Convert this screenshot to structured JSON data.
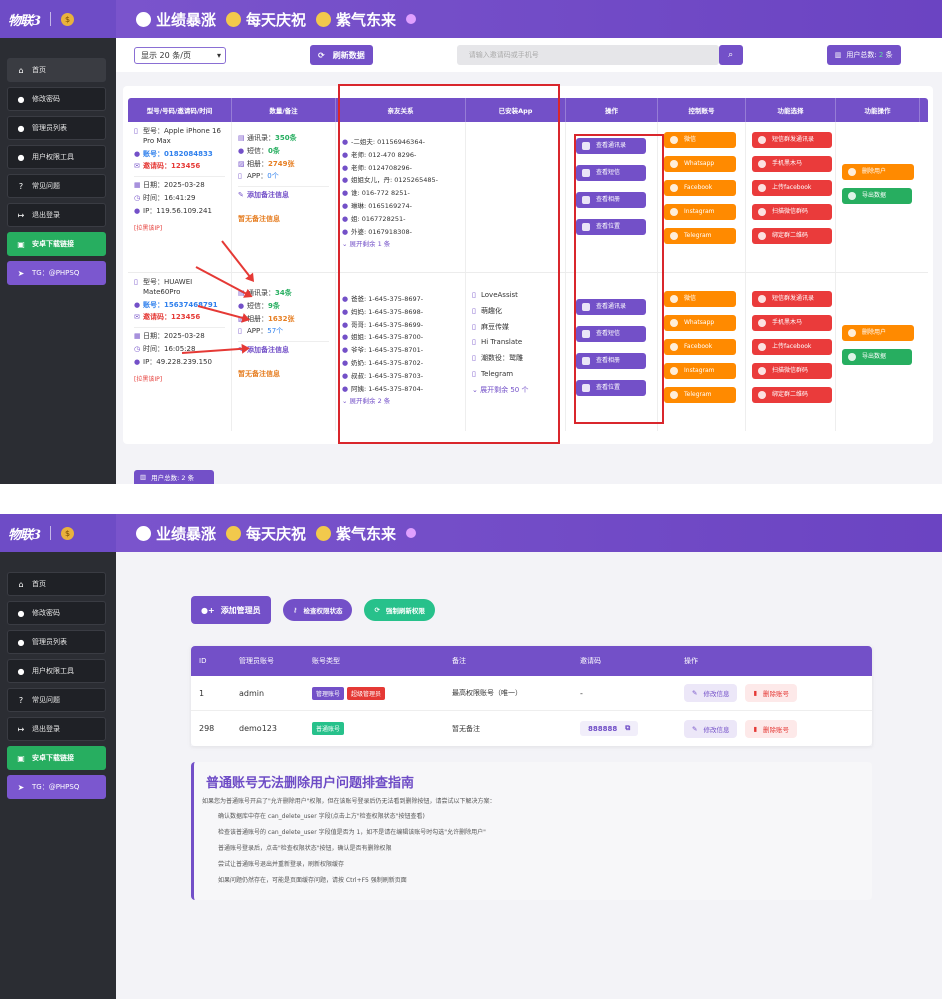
{
  "brand": {
    "logo": "物联3",
    "emoji_line": [
      "业绩暴涨",
      "每天庆祝",
      "紫气东来"
    ]
  },
  "sidebar": {
    "items": [
      {
        "label": "首页",
        "icon": "home-icon"
      },
      {
        "label": "修改密码",
        "icon": "user-edit-icon"
      },
      {
        "label": "管理员列表",
        "icon": "users-icon"
      },
      {
        "label": "用户权限工具",
        "icon": "user-tool-icon"
      },
      {
        "label": "常见问题",
        "icon": "question-icon"
      },
      {
        "label": "退出登录",
        "icon": "logout-icon"
      },
      {
        "label": "安卓下载链接",
        "icon": "android-icon"
      },
      {
        "label": "TG：@PHPSQ",
        "icon": "telegram-icon"
      }
    ]
  },
  "shot1": {
    "toolbar": {
      "page_size": "显示 20 条/页",
      "refresh": "刷新数据",
      "search_placeholder": "请输入邀请码或手机号",
      "total_label": "用户总数:",
      "total_value": "2",
      "total_unit": "条"
    },
    "headers": [
      "型号/号码/邀请码/时间",
      "数量/备注",
      "亲友关系",
      "已安装App",
      "操作",
      "控制账号",
      "功能选择",
      "功能操作"
    ],
    "rows": [
      {
        "model": "型号：Apple iPhone 16 Pro Max",
        "account": "账号：0182084833",
        "invite": "邀请码：123456",
        "date": "日期：2025-03-28",
        "time": "时间：16:41:29",
        "ip": "IP：119.56.109.241",
        "pull": "[拉黑该IP]",
        "contacts_label": "通讯录：",
        "contacts": "350条",
        "sms_label": "短信：",
        "sms": "0条",
        "photos_label": "相册：",
        "photos": "2749张",
        "app_label": "APP：",
        "app": "0个",
        "add_note": "添加备注信息",
        "no_note": "暂无备注信息",
        "relations": [
          "-二姐夫: 01156946364-",
          "老师: 012-470 8296-",
          "老师: 0124708296-",
          "姐姐女儿，丹: 0125265485-",
          "谁: 016-772 8251-",
          "琳琳: 0165169274-",
          "姐: 0167728251-",
          "外婆: 0167918308-"
        ],
        "expand_rel": "展开剩余 1 条",
        "apps": [],
        "expand_apps": ""
      },
      {
        "model": "型号：HUAWEI Mate60Pro",
        "account": "账号：15637468791",
        "invite": "邀请码：123456",
        "date": "日期：2025-03-28",
        "time": "时间：16:05:28",
        "ip": "IP：49.228.239.150",
        "pull": "[拉黑该IP]",
        "contacts_label": "通讯录：",
        "contacts": "34条",
        "sms_label": "短信：",
        "sms": "9条",
        "photos_label": "相册：",
        "photos": "1632张",
        "app_label": "APP：",
        "app": "57个",
        "add_note": "添加备注信息",
        "no_note": "暂无备注信息",
        "relations": [
          "爸爸: 1-645-375-8697-",
          "妈妈: 1-645-375-8698-",
          "哥哥: 1-645-375-8699-",
          "姐姐: 1-645-375-8700-",
          "爷爷: 1-645-375-8701-",
          "奶奶: 1-645-375-8702-",
          "叔叔: 1-645-375-8703-",
          "阿姨: 1-645-375-8704-"
        ],
        "expand_rel": "展开剩余 2 条",
        "apps": [
          "LoveAssist",
          "萌趣化",
          "麻豆传媒",
          "Hi Translate",
          "潮数役：鹫雕",
          "Telegram"
        ],
        "expand_apps": "展开剩余 50 个"
      }
    ],
    "ops": [
      "查看通讯录",
      "查看短信",
      "查看相册",
      "查看位置"
    ],
    "control": [
      "微信",
      "Whatsapp",
      "Facebook",
      "Instagram",
      "Telegram"
    ],
    "features": [
      "短信群发通讯录",
      "手机黑木马",
      "上传facebook",
      "扫描微信群码",
      "绑定群二维码"
    ],
    "actions": [
      "删除用户",
      "导出数据"
    ],
    "bottom_tab": "用户总数: 2 条"
  },
  "shot2": {
    "add_admin": "添加管理员",
    "check_perm": "检查权限状态",
    "force_refresh": "强制刷新权限",
    "headers": [
      "ID",
      "管理员账号",
      "账号类型",
      "备注",
      "邀请码",
      "操作"
    ],
    "rows": [
      {
        "id": "1",
        "account": "admin",
        "tags": [
          "管理账号",
          "超级管理员"
        ],
        "note": "最高权限账号（唯一）",
        "invite": "-",
        "edit": "修改信息",
        "del": "删除账号"
      },
      {
        "id": "298",
        "account": "demo123",
        "tags": [
          "普通账号"
        ],
        "note": "暂无备注",
        "invite": "888888",
        "edit": "修改信息",
        "del": "删除账号"
      }
    ],
    "guide": {
      "title": "普通账号无法删除用户问题排查指南",
      "intro": "如果您为普通账号开启了\"允许删除用户\"权限，但在该账号登录后仍无法看到删除按钮，请尝试以下解决方案：",
      "items": [
        "确认数据库中存在 can_delete_user 字段(点击上方\"检查权限状态\"按钮查看)",
        "检查该普通账号的 can_delete_user 字段值是否为 1，如不是请在编辑该账号时勾选\"允许删除用户\"",
        "普通账号登录后，点击\"检查权限状态\"按钮，确认是否有删除权限",
        "尝试让普通账号退出并重新登录，刷新权限缓存",
        "如果问题仍然存在，可能是页面缓存问题，请按 Ctrl+F5 强制刷新页面"
      ]
    }
  }
}
